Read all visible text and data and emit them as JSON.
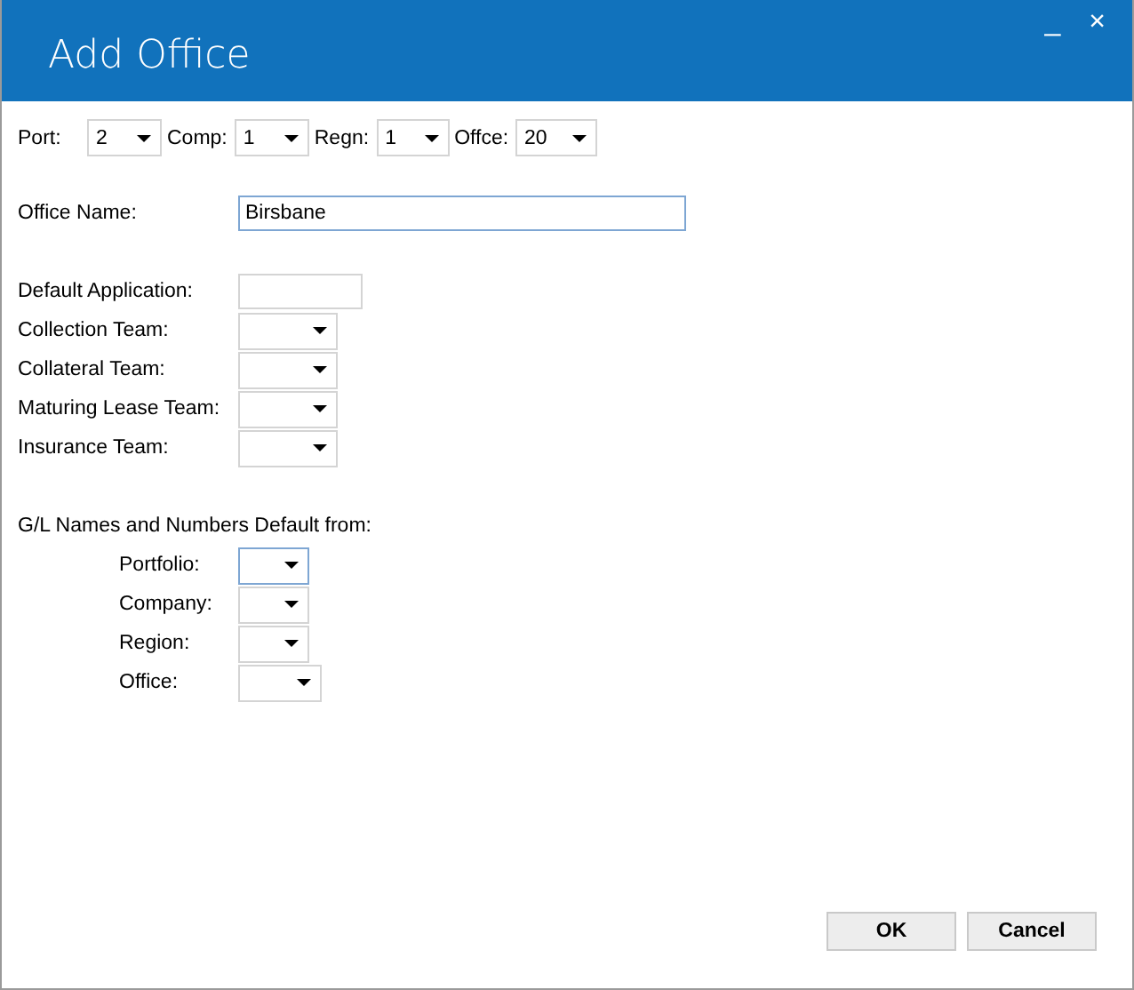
{
  "window": {
    "title": "Add Office",
    "controls": [
      "_",
      "×"
    ]
  },
  "selectors": [
    {
      "label": "Port:",
      "value": "2"
    },
    {
      "label": "Comp:",
      "value": "1"
    },
    {
      "label": "Regn:",
      "value": "1"
    },
    {
      "label": "Offce:",
      "value": "20"
    }
  ],
  "office_name": {
    "label": "Office Name:",
    "value": "Birsbane",
    "focused": true
  },
  "default_application": {
    "label": "Default Application:"
  },
  "teams": [
    {
      "label": "Collection Team:"
    },
    {
      "label": "Collateral Team:"
    },
    {
      "label": "Maturing Lease Team:"
    },
    {
      "label": "Insurance Team:"
    }
  ],
  "gl_defaults": {
    "heading": "G/L Names and Numbers Default from:",
    "items": [
      {
        "label": "Portfolio:",
        "focused": true,
        "kind": "narrow"
      },
      {
        "label": "Company:",
        "focused": false,
        "kind": "narrow"
      },
      {
        "label": "Region:",
        "focused": false,
        "kind": "narrow"
      },
      {
        "label": "Office:",
        "focused": false,
        "kind": "wide"
      }
    ]
  },
  "buttons": [
    "OK",
    "Cancel"
  ]
}
